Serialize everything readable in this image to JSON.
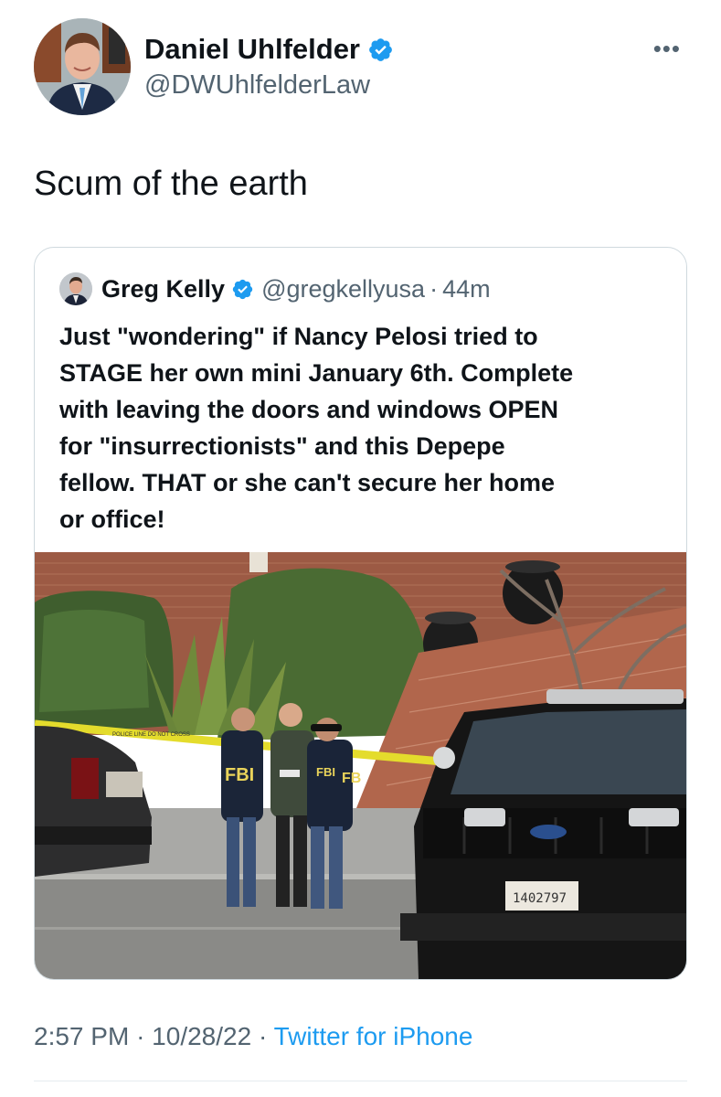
{
  "tweet": {
    "author_name": "Daniel Uhlfelder",
    "author_handle": "@DWUhlfelderLaw",
    "text": "Scum of the earth",
    "time": "2:57 PM",
    "date": "10/28/22",
    "source": "Twitter for iPhone",
    "separator": "·"
  },
  "quoted": {
    "author_name": "Greg Kelly",
    "author_handle": "@gregkellyusa",
    "separator": "·",
    "time_ago": "44m",
    "text_lines": [
      "Just \"wondering\" if Nancy Pelosi tried to",
      "STAGE her own mini January 6th. Complete",
      "with leaving the doors and windows OPEN",
      "for \"insurrectionists\" and this Depepe",
      "fellow. THAT or she can't secure her home",
      "or office!"
    ],
    "photo": {
      "vest_labels": [
        "FBI",
        "FBI",
        "FB"
      ],
      "tape_text": "POLICE LINE DO NOT CROSS",
      "plate": "1402797"
    }
  },
  "icons": {
    "more": "more-options-icon",
    "verified": "verified-badge-icon"
  },
  "colors": {
    "verified": "#1d9bf0",
    "link": "#1d9bf0",
    "secondary_text": "#536471"
  }
}
